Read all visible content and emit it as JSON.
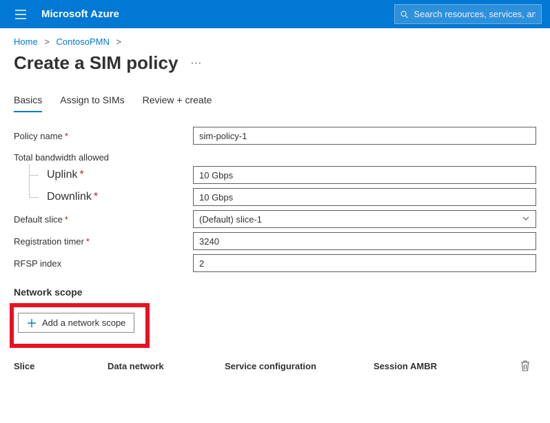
{
  "topbar": {
    "brand": "Microsoft Azure",
    "search_placeholder": "Search resources, services, and docs"
  },
  "breadcrumb": {
    "home": "Home",
    "item": "ContosoPMN"
  },
  "page": {
    "title": "Create a SIM policy"
  },
  "tabs": {
    "basics": "Basics",
    "assign": "Assign to SIMs",
    "review": "Review + create"
  },
  "form": {
    "policy_name_label": "Policy name",
    "policy_name_value": "sim-policy-1",
    "bandwidth_label": "Total bandwidth allowed",
    "uplink_label": "Uplink",
    "uplink_value": "10 Gbps",
    "downlink_label": "Downlink",
    "downlink_value": "10 Gbps",
    "default_slice_label": "Default slice",
    "default_slice_value": "(Default) slice-1",
    "reg_timer_label": "Registration timer",
    "reg_timer_value": "3240",
    "rfsp_label": "RFSP index",
    "rfsp_value": "2"
  },
  "network_scope": {
    "title": "Network scope",
    "add_button": "Add a network scope",
    "columns": {
      "slice": "Slice",
      "data_network": "Data network",
      "service_config": "Service configuration",
      "session_ambr": "Session AMBR"
    }
  }
}
